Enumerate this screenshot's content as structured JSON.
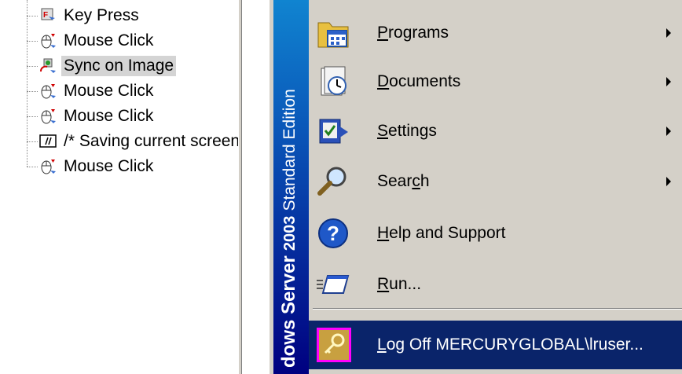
{
  "tree": {
    "items": [
      {
        "label": "Key Press",
        "icon": "key-press-icon"
      },
      {
        "label": "Mouse Click",
        "icon": "mouse-icon"
      },
      {
        "label": "Sync on Image",
        "icon": "sync-image-icon"
      },
      {
        "label": "Mouse Click",
        "icon": "mouse-icon"
      },
      {
        "label": "Mouse Click",
        "icon": "mouse-icon"
      },
      {
        "label": "/* Saving current screen",
        "icon": "comment-icon"
      },
      {
        "label": "Mouse Click",
        "icon": "mouse-icon"
      }
    ],
    "selected_index": 2,
    "selected_color": "#d4d4d4"
  },
  "start_menu": {
    "banner": {
      "part1": "dows Server",
      "part2": "2003",
      "part3": "Standard Edition"
    },
    "items": [
      {
        "label_prefix": "",
        "label_key": "P",
        "label_rest": "rograms",
        "icon": "programs-folder-icon",
        "has_submenu": true
      },
      {
        "label_prefix": "",
        "label_key": "D",
        "label_rest": "ocuments",
        "icon": "documents-icon",
        "has_submenu": true
      },
      {
        "label_prefix": "",
        "label_key": "S",
        "label_rest": "ettings",
        "icon": "settings-icon",
        "has_submenu": true
      },
      {
        "label_prefix": "Sear",
        "label_key": "c",
        "label_rest": "h",
        "icon": "search-icon",
        "has_submenu": true
      },
      {
        "label_prefix": "",
        "label_key": "H",
        "label_rest": "elp and Support",
        "icon": "help-icon",
        "has_submenu": false
      },
      {
        "label_prefix": "",
        "label_key": "R",
        "label_rest": "un...",
        "icon": "run-icon",
        "has_submenu": false
      }
    ],
    "logoff": {
      "label_prefix": "",
      "label_key": "L",
      "label_rest": "og Off MERCURYGLOBAL\\lruser...",
      "icon": "key-icon"
    },
    "colors": {
      "banner_top": "#1084d0",
      "banner_bottom": "#000080",
      "highlight": "#0a246a",
      "menu_bg": "#d4d0c8",
      "focus_box": "#ff00ff"
    }
  }
}
